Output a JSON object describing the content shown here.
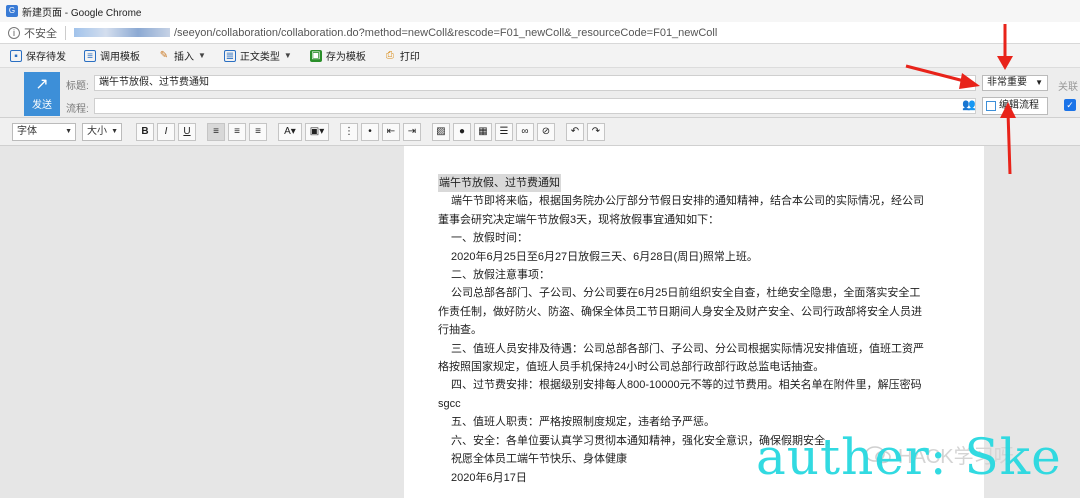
{
  "window": {
    "favicon": "G",
    "title": "新建页面 - Google Chrome",
    "security_label": "不安全",
    "url": "/seeyon/collaboration/collaboration.do?method=newColl&rescode=F01_newColl&_resourceCode=F01_newColl"
  },
  "toolbar": {
    "items": [
      {
        "icon": "save-icon",
        "label": "保存待发",
        "color": "#2a6fc2"
      },
      {
        "icon": "template-icon",
        "label": "调用模板",
        "color": "#2a6fc2"
      },
      {
        "icon": "insert-icon",
        "label": "插入",
        "color": "#c9761e"
      },
      {
        "icon": "body-type-icon",
        "label": "正文类型",
        "color": "#2a6fc2"
      },
      {
        "icon": "save-template-icon",
        "label": "存为模板",
        "color": "#2a8f2a"
      },
      {
        "icon": "print-icon",
        "label": "打印",
        "color": "#d98a14"
      }
    ]
  },
  "form": {
    "send_label": "发送",
    "subject_label": "标题:",
    "subject_value": "端午节放假、过节费通知",
    "flow_label": "流程:",
    "priority_value": "非常重要",
    "assoc_label": "关联",
    "edit_flow_label": "编辑流程"
  },
  "editor": {
    "font_combo": "字体",
    "size_combo": "大小"
  },
  "document": {
    "lines": [
      "端午节放假、过节费通知",
      "端午节即将来临，根据国务院办公厅部分节假日安排的通知精神，结合本公司的实际情况，经公司",
      "董事会研究决定端午节放假3天，现将放假事宜通知如下：",
      "一、放假时间：",
      "2020年6月25日至6月27日放假三天、6月28日(周日)照常上班。",
      "二、放假注意事项：",
      "公司总部各部门、子公司、分公司要在6月25日前组织安全自查，杜绝安全隐患，全面落实安全工",
      "作责任制，做好防火、防盗、确保全体员工节日期间人身安全及财产安全、公司行政部将安全人员进",
      "行抽查。",
      "三、值班人员安排及待遇：公司总部各部门、子公司、分公司根据实际情况安排值班，值班工资严",
      "格按照国家规定，值班人员手机保持24小时公司总部行政部行政总监电话抽查。",
      "四、过节费安排：根据级别安排每人800-10000元不等的过节费用。相关名单在附件里，解压密码",
      "sgcc",
      "五、值班人职责：严格按照制度规定，违者给予严惩。",
      "六、安全：各单位要认真学习贯彻本通知精神，强化安全意识，确保假期安全。",
      "祝愿全体员工端午节快乐、身体健康",
      "2020年6月17日"
    ]
  },
  "overlay": {
    "wechat_text": "HACK学习呀",
    "watermark_text": "auther: Ske",
    "arrow_color": "#e8231a",
    "watermark_color": "#28d9e0"
  }
}
